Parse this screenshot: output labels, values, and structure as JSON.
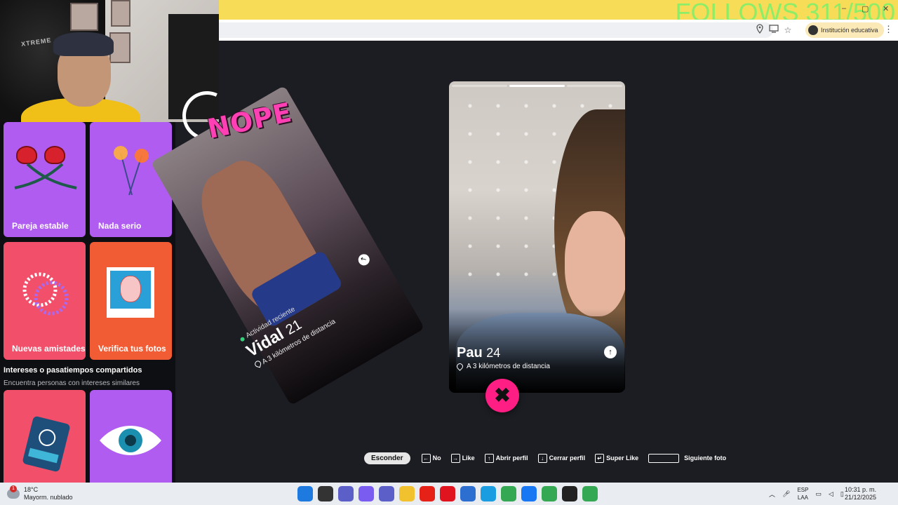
{
  "stream": {
    "follows_goal": "FOLLOWS 311/500"
  },
  "browser": {
    "profile_label": "Institución educativa",
    "window_controls": [
      "–",
      "▢",
      "✕"
    ]
  },
  "left_panel": {
    "tiles": [
      {
        "label": "Pareja estable",
        "color": "#b05cf0"
      },
      {
        "label": "Nada serio",
        "color": "#b05cf0"
      },
      {
        "label": "Nuevas amistades",
        "color": "#f2506a"
      },
      {
        "label": "Verifica tus fotos",
        "color": "#f25c34"
      }
    ],
    "section_title": "Intereses o pasatiempos compartidos",
    "section_subtitle": "Encuentra personas con intereses similares",
    "bottom_tiles": [
      {
        "color": "#f2506a",
        "icon": "passport-icon"
      },
      {
        "color": "#b05cf0",
        "icon": "eye-icon"
      }
    ]
  },
  "swiped_profile": {
    "stamp": "NOPE",
    "activity": "Actividad reciente",
    "name": "Vidal",
    "age": "21",
    "distance": "A 3 kilómetros de distancia"
  },
  "current_profile": {
    "name": "Pau",
    "age": "24",
    "distance": "A 3 kilómetros de distancia",
    "photo_count": 3,
    "active_photo": 2
  },
  "actions": {
    "nope_symbol": "✖"
  },
  "shortcuts": {
    "hide": "Esconder",
    "items": [
      {
        "key": "←",
        "label": "No"
      },
      {
        "key": "→",
        "label": "Like"
      },
      {
        "key": "↑",
        "label": "Abrir perfil"
      },
      {
        "key": "↓",
        "label": "Cerrar perfil"
      },
      {
        "key": "↵",
        "label": "Super Like"
      },
      {
        "key": "",
        "label": "Siguiente foto"
      }
    ]
  },
  "taskbar": {
    "weather_badge": "1",
    "temperature": "18°C",
    "condition": "Mayorm. nublado",
    "lang_line1": "ESP",
    "lang_line2": "LAA",
    "time": "10:31 p. m.",
    "date": "21/12/2025",
    "apps": [
      {
        "icon": "windows-icon",
        "color": "#1f7ae0"
      },
      {
        "icon": "task-view-icon",
        "color": "#333"
      },
      {
        "icon": "chat-icon",
        "color": "#5b5fc7"
      },
      {
        "icon": "copilot-icon",
        "color": "#7a5cf0"
      },
      {
        "icon": "teams-icon",
        "color": "#5b5fc7"
      },
      {
        "icon": "file-explorer-icon",
        "color": "#f2c12e"
      },
      {
        "icon": "youtube-icon",
        "color": "#e62117"
      },
      {
        "icon": "opera-icon",
        "color": "#e0141e"
      },
      {
        "icon": "store-icon",
        "color": "#2d6fd1"
      },
      {
        "icon": "edge-icon",
        "color": "#1b9de2"
      },
      {
        "icon": "chrome-icon",
        "color": "#34a853"
      },
      {
        "icon": "facebook-icon",
        "color": "#1877f2"
      },
      {
        "icon": "chrome-icon",
        "color": "#34a853"
      },
      {
        "icon": "obs-icon",
        "color": "#222"
      },
      {
        "icon": "chrome-icon",
        "color": "#34a853"
      }
    ]
  }
}
